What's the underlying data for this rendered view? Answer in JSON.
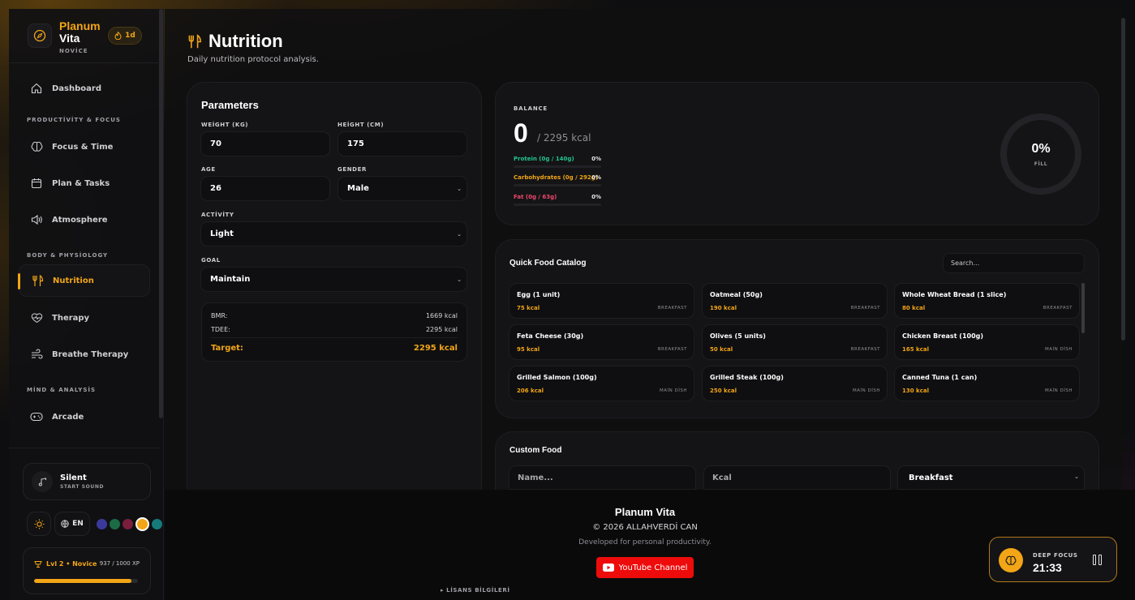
{
  "brand": {
    "name_line1": "Planum",
    "name_line2": "Vita",
    "rank": "NOVİCE",
    "streak": "1d"
  },
  "sidebar": {
    "items": [
      {
        "label": "Dashboard"
      },
      {
        "label": "Focus & Time"
      },
      {
        "label": "Plan & Tasks"
      },
      {
        "label": "Atmosphere"
      },
      {
        "label": "Nutrition"
      },
      {
        "label": "Therapy"
      },
      {
        "label": "Breathe Therapy"
      },
      {
        "label": "Arcade"
      }
    ],
    "sections": [
      "PRODUCTİVİTY & FOCUS",
      "BODY & PHYSİOLOGY",
      "MİND & ANALYSİS"
    ],
    "sound": {
      "title": "Silent",
      "subtitle": "START SOUND"
    },
    "language": "EN",
    "theme_swatches": [
      "#3b3a9a",
      "#1c6b45",
      "#7a1e3c",
      "#f2a516",
      "#167a7a"
    ],
    "xp": {
      "level": "Lvl 2 • Novice",
      "value": "937 / 1000 XP",
      "progress": 0.937
    }
  },
  "page": {
    "title": "Nutrition",
    "subtitle": "Daily nutrition protocol analysis."
  },
  "parameters": {
    "title": "Parameters",
    "weight_label": "WEİGHT (KG)",
    "weight": "70",
    "height_label": "HEİGHT (CM)",
    "height": "175",
    "age_label": "AGE",
    "age": "26",
    "gender_label": "GENDER",
    "gender": "Male",
    "activity_label": "ACTİVİTY",
    "activity": "Light",
    "goal_label": "GOAL",
    "goal": "Maintain",
    "bmr_label": "BMR:",
    "bmr": "1669 kcal",
    "tdee_label": "TDEE:",
    "tdee": "2295 kcal",
    "target_label": "Target:",
    "target": "2295 kcal"
  },
  "balance": {
    "label": "BALANCE",
    "value": "0",
    "goal": "/ 2295 kcal",
    "fill_pct": "0%",
    "fill_label": "FİLL",
    "macros": [
      {
        "label": "Protein (0g / 140g)",
        "pct": "0%",
        "color": "#22c38e"
      },
      {
        "label": "Carbohydrates (0g / 292g)",
        "pct": "0%",
        "color": "#f2a516"
      },
      {
        "label": "Fat (0g / 63g)",
        "pct": "0%",
        "color": "#f0476a"
      }
    ]
  },
  "catalog": {
    "title": "Quick Food Catalog",
    "search_placeholder": "Search...",
    "foods": [
      {
        "name": "Egg (1 unit)",
        "kcal": "75 kcal",
        "category": "BREAKFAST"
      },
      {
        "name": "Oatmeal (50g)",
        "kcal": "190 kcal",
        "category": "BREAKFAST"
      },
      {
        "name": "Whole Wheat Bread (1 slice)",
        "kcal": "80 kcal",
        "category": "BREAKFAST"
      },
      {
        "name": "Feta Cheese (30g)",
        "kcal": "95 kcal",
        "category": "BREAKFAST"
      },
      {
        "name": "Olives (5 units)",
        "kcal": "50 kcal",
        "category": "BREAKFAST"
      },
      {
        "name": "Chicken Breast (100g)",
        "kcal": "165 kcal",
        "category": "MAİN DİSH"
      },
      {
        "name": "Grilled Salmon (100g)",
        "kcal": "206 kcal",
        "category": "MAİN DİSH"
      },
      {
        "name": "Grilled Steak (100g)",
        "kcal": "250 kcal",
        "category": "MAİN DİSH"
      },
      {
        "name": "Canned Tuna (1 can)",
        "kcal": "130 kcal",
        "category": "MAİN DİSH"
      }
    ]
  },
  "custom_food": {
    "title": "Custom Food",
    "name_placeholder": "Name...",
    "kcal_placeholder": "Kcal",
    "meal": "Breakfast"
  },
  "footer": {
    "name": "Planum Vita",
    "copyright": "© 2026 ALLAHVERDİ CAN",
    "developed": "Developed for personal productivity.",
    "youtube": "YouTube Channel",
    "license": "▸ LİSANS BİLGİLERİ"
  },
  "focus_widget": {
    "label": "DEEP FOCUS",
    "time": "21:33"
  }
}
